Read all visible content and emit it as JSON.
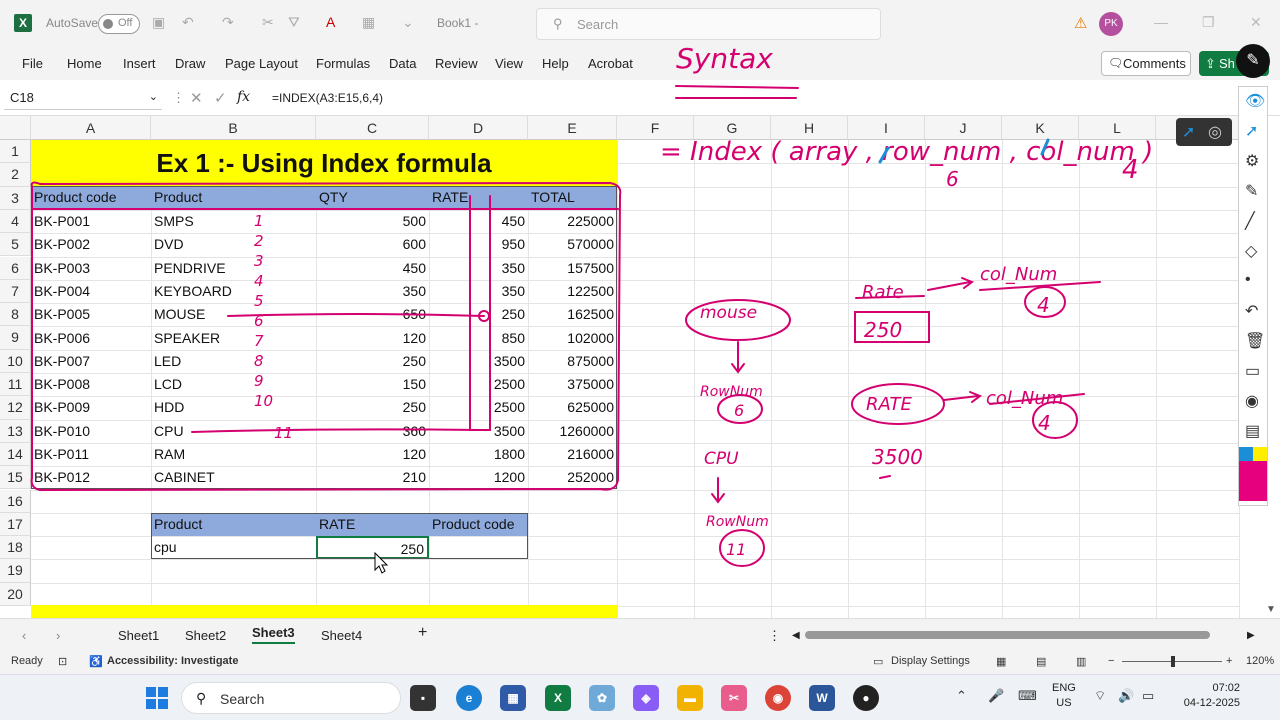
{
  "titlebar": {
    "autosave_label": "AutoSave",
    "autosave_state": "Off",
    "doc_title": "Book1 -",
    "search_placeholder": "Search",
    "avatar_initials": "PK"
  },
  "menu": [
    "File",
    "Home",
    "Insert",
    "Draw",
    "Page Layout",
    "Formulas",
    "Data",
    "Review",
    "View",
    "Help",
    "Acrobat"
  ],
  "buttons": {
    "comments": "Comments",
    "share": "Sh"
  },
  "formula_bar": {
    "name_box": "C18",
    "fx": "fx",
    "formula": "=INDEX(A3:E15,6,4)"
  },
  "columns": [
    "A",
    "B",
    "C",
    "D",
    "E",
    "F",
    "G",
    "H",
    "I",
    "J",
    "K",
    "L"
  ],
  "rows": [
    "1",
    "2",
    "3",
    "4",
    "5",
    "6",
    "7",
    "8",
    "9",
    "10",
    "11",
    "12",
    "13",
    "14",
    "15",
    "16",
    "17",
    "18",
    "19",
    "20"
  ],
  "sheet": {
    "title": "Ex 1 :- Using Index formula",
    "headers": [
      "Product code",
      "Product",
      "QTY",
      "RATE",
      "TOTAL"
    ],
    "data": [
      [
        "BK-P001",
        "SMPS",
        "500",
        "450",
        "225000"
      ],
      [
        "BK-P002",
        "DVD",
        "600",
        "950",
        "570000"
      ],
      [
        "BK-P003",
        "PENDRIVE",
        "450",
        "350",
        "157500"
      ],
      [
        "BK-P004",
        "KEYBOARD",
        "350",
        "350",
        "122500"
      ],
      [
        "BK-P005",
        "MOUSE",
        "650",
        "250",
        "162500"
      ],
      [
        "BK-P006",
        "SPEAKER",
        "120",
        "850",
        "102000"
      ],
      [
        "BK-P007",
        "LED",
        "250",
        "3500",
        "875000"
      ],
      [
        "BK-P008",
        "LCD",
        "150",
        "2500",
        "375000"
      ],
      [
        "BK-P009",
        "HDD",
        "250",
        "2500",
        "625000"
      ],
      [
        "BK-P010",
        "CPU",
        "360",
        "3500",
        "1260000"
      ],
      [
        "BK-P011",
        "RAM",
        "120",
        "1800",
        "216000"
      ],
      [
        "BK-P012",
        "CABINET",
        "210",
        "1200",
        "252000"
      ]
    ],
    "lookup_headers": [
      "Product",
      "RATE",
      "Product code"
    ],
    "lookup_values": [
      "cpu",
      "250",
      ""
    ]
  },
  "tabs": [
    "Sheet1",
    "Sheet2",
    "Sheet3",
    "Sheet4"
  ],
  "active_tab": "Sheet3",
  "status": {
    "ready": "Ready",
    "accessibility": "Accessibility: Investigate",
    "display": "Display Settings",
    "zoom": "120%"
  },
  "taskbar": {
    "search": "Search",
    "lang1": "ENG",
    "lang2": "US",
    "time": "07:02",
    "date": "04-12-2025"
  },
  "annotations": {
    "syntax": "Syntax",
    "index_syntax": "= Index ( array , row_num , col_num )",
    "row6": "6",
    "col4": "4",
    "mouse": "mouse",
    "rownum1": "RowNum",
    "six": "6",
    "cpu": "CPU",
    "rownum2": "RowNum",
    "eleven": "11",
    "rate1": "Rate",
    "val250": "250",
    "colnum1": "col_Num",
    "four1": "4",
    "rate2": "RATE",
    "colnum2": "col_Num",
    "four2": "4",
    "val3500": "3500",
    "row_marks": [
      "1",
      "2",
      "3",
      "4",
      "5",
      "6",
      "7",
      "8",
      "9",
      "10",
      "11"
    ]
  },
  "colors": {
    "title_fill": "#ffff00",
    "header_fill": "#8ea9db",
    "ink": "#d4006f",
    "ink_blue": "#1a8fd8",
    "excel_green": "#107c41"
  }
}
